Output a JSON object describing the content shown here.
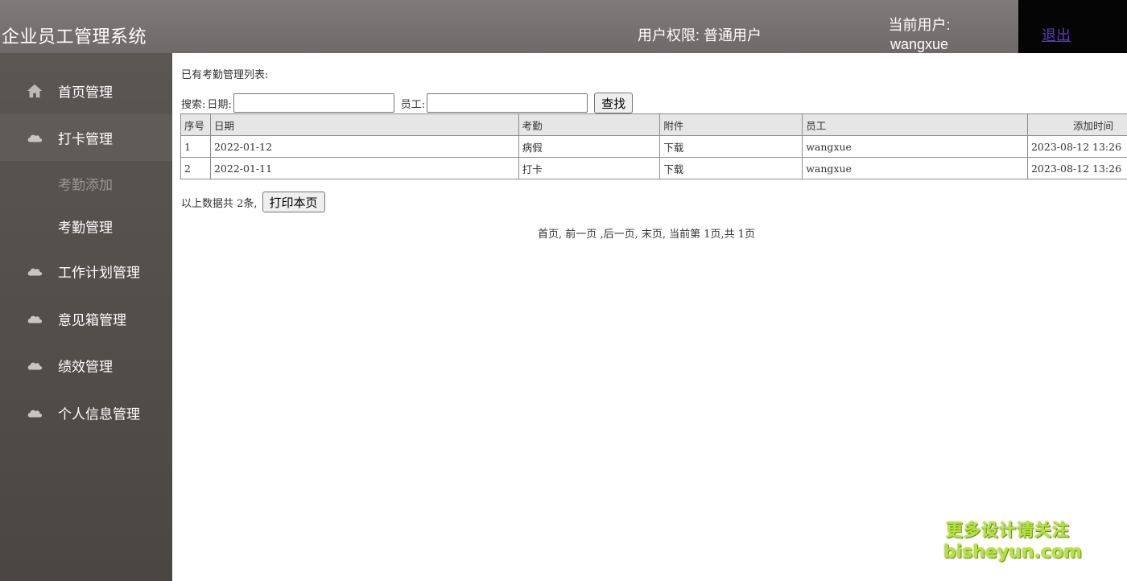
{
  "header": {
    "app_title": "企业员工管理系统",
    "user_role": "用户权限: 普通用户",
    "current_user_label": "当前用户:",
    "current_user_name": "wangxue",
    "logout": "退出"
  },
  "sidebar": {
    "items": [
      {
        "label": "首页管理",
        "icon": "home-icon"
      },
      {
        "label": "打卡管理",
        "icon": "cloud-icon"
      },
      {
        "label": "工作计划管理",
        "icon": "cloud-icon"
      },
      {
        "label": "意见箱管理",
        "icon": "cloud-icon"
      },
      {
        "label": "绩效管理",
        "icon": "cloud-icon"
      },
      {
        "label": "个人信息管理",
        "icon": "cloud-icon"
      }
    ],
    "sub_items": [
      {
        "label": "考勤添加"
      },
      {
        "label": "考勤管理"
      }
    ]
  },
  "main": {
    "list_title": "已有考勤管理列表:",
    "search": {
      "prefix": "搜索:",
      "date_label": "日期:",
      "date_value": "",
      "employee_label": "员工:",
      "employee_value": "",
      "button": "查找"
    },
    "table": {
      "columns": [
        "序号",
        "日期",
        "考勤",
        "附件",
        "员工",
        "添加时间"
      ],
      "rows": [
        [
          "1",
          "2022-01-12",
          "病假",
          "下载",
          "wangxue",
          "2023-08-12 13:26"
        ],
        [
          "2",
          "2022-01-11",
          "打卡",
          "下载",
          "wangxue",
          "2023-08-12 13:26"
        ]
      ]
    },
    "summary": "以上数据共 2条,",
    "print_button": "打印本页",
    "pager": {
      "first": "首页,",
      "prev": "前一页",
      "next": ",后一页,",
      "last": "末页,",
      "status": "当前第 1页,共 1页"
    }
  },
  "watermark": {
    "line1": "更多设计请关注",
    "line2": "bisheyun.com"
  },
  "colors": {
    "header_bg": "#77726f",
    "sidebar_bg": "#524e4a",
    "logout_bg": "#050505",
    "logout_link": "#5a38c7",
    "watermark": "#b6e43c"
  }
}
